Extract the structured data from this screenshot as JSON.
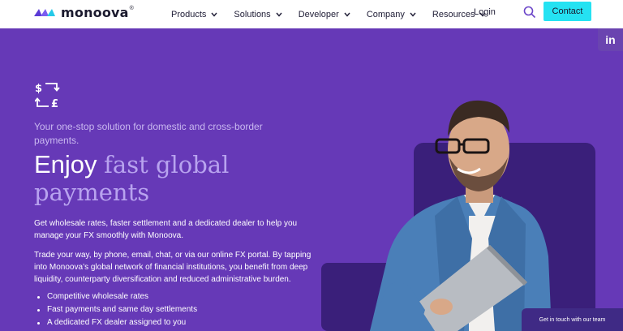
{
  "header": {
    "logo_text": "monoova",
    "logo_reg": "®",
    "nav": [
      {
        "label": "Products"
      },
      {
        "label": "Solutions"
      },
      {
        "label": "Developer"
      },
      {
        "label": "Company"
      },
      {
        "label": "Resources"
      }
    ],
    "login_label": "Login",
    "contact_label": "Contact"
  },
  "social": {
    "linkedin_label": "in"
  },
  "hero": {
    "tagline": "Your one-stop solution for domestic and cross-border payments.",
    "headline_plain": "Enjoy",
    "headline_em_1": "fast global",
    "headline_em_2": "payments",
    "para1": "Get wholesale rates, faster settlement and a dedicated dealer to help you manage your FX smoothly with Monoova.",
    "para2": "Trade your way, by phone, email, chat, or via our online FX portal. By tapping into Monoova’s global network of financial institutions, you benefit from deep liquidity, counterparty diversification and reduced administrative burden.",
    "bullets": [
      "Competitive wholesale rates",
      "Fast payments and same day settlements",
      "A dedicated FX dealer assigned to you"
    ]
  },
  "chat": {
    "label": "Get in touch with our team"
  },
  "colors": {
    "hero_bg": "#6639b7",
    "accent_cyan": "#25e2f2",
    "dark_purple": "#3a1f7a",
    "headline_em": "#b8a3ef"
  },
  "icons": [
    "fx-exchange-icon",
    "search-icon",
    "chevron-down-icon",
    "linkedin-icon"
  ]
}
